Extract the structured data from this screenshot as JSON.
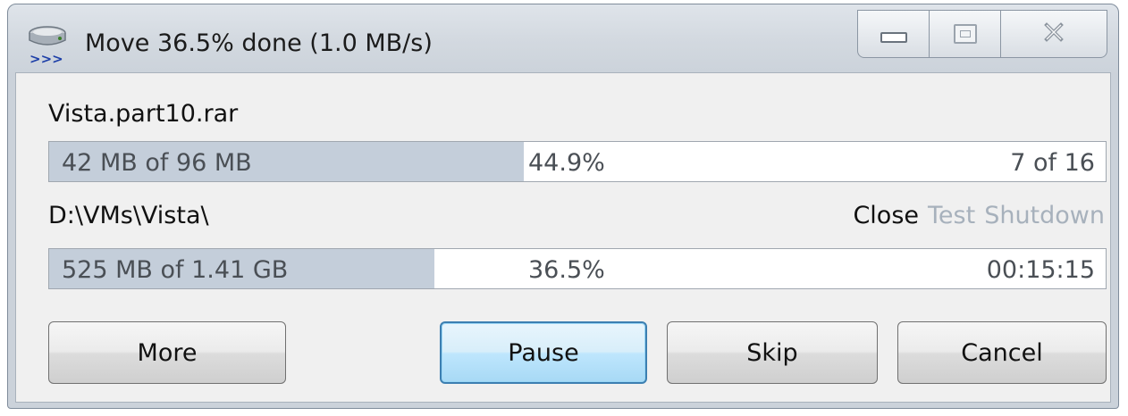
{
  "window": {
    "title": "Move 36.5% done (1.0 MB/s)",
    "icon": "drive-move-icon",
    "caption_buttons": [
      "minimize-icon",
      "maximize-icon",
      "close-icon"
    ]
  },
  "file": {
    "name": "Vista.part10.rar",
    "progress": {
      "amount_text": "42 MB of 96 MB",
      "percent_text": "44.9%",
      "count_text": "7 of 16",
      "fraction": 0.449
    }
  },
  "destination": {
    "path": "D:\\VMs\\Vista\\",
    "after_actions": {
      "close": "Close",
      "test": "Test",
      "shutdown": "Shutdown"
    }
  },
  "total": {
    "progress": {
      "amount_text": "525 MB of 1.41 GB",
      "percent_text": "36.5%",
      "time_text": "00:15:15",
      "fraction": 0.365
    }
  },
  "buttons": {
    "more": "More",
    "pause": "Pause",
    "skip": "Skip",
    "cancel": "Cancel"
  },
  "colors": {
    "progress_fill": "#c4ceda",
    "primary_button": "#bee6fd"
  }
}
